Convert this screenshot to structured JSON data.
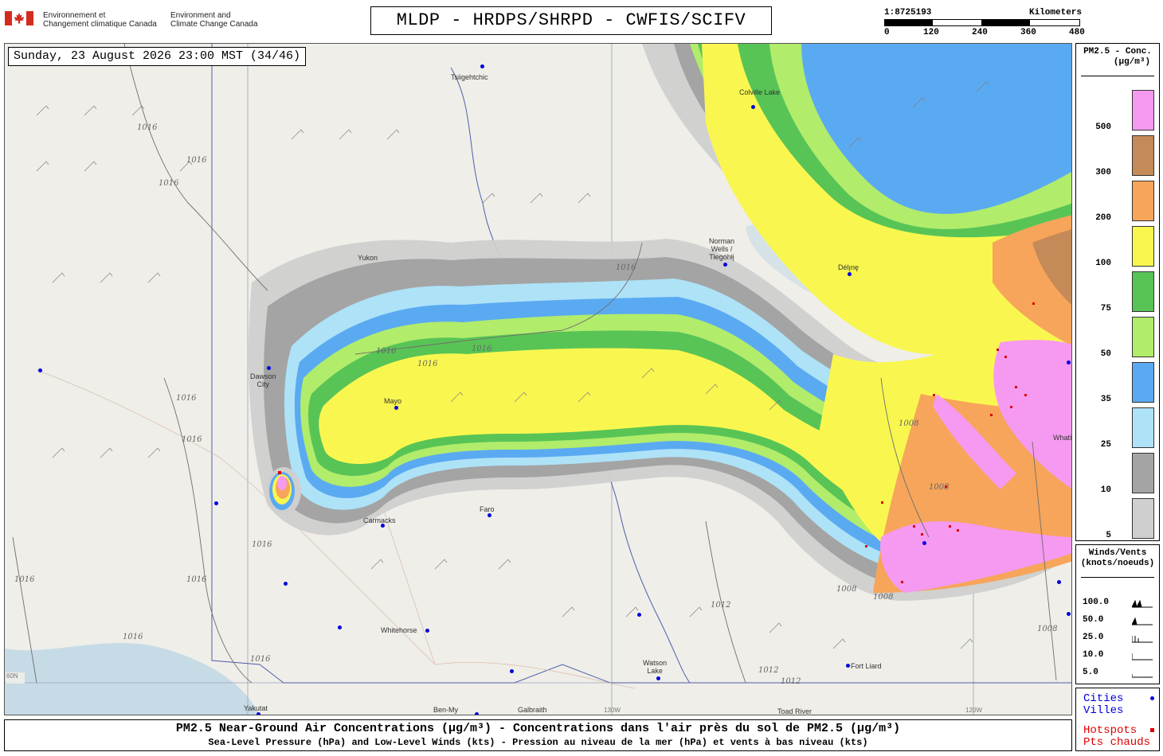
{
  "header": {
    "gov_fr": [
      "Environnement et",
      "Changement climatique Canada"
    ],
    "gov_en": [
      "Environment and",
      "Climate Change Canada"
    ],
    "title": "MLDP - HRDPS/SHRPD - CWFIS/SCIFV",
    "scale_ratio": "1:8725193",
    "scale_unit": "Kilometers",
    "scale_ticks": [
      "0",
      "120",
      "240",
      "360",
      "480"
    ]
  },
  "map": {
    "timestamp": "Sunday, 23 August 2026 23:00 MST (34/46)",
    "places": {
      "tsiigehtchic": "Tsiigehtchic",
      "colville": "Colville Lake",
      "norman_wells": [
        "Norman",
        "Wells /",
        "Tłegóhłį"
      ],
      "deline": "Délı̨nę",
      "yukon": "Yukon",
      "dawson": [
        "Dawson",
        "City"
      ],
      "mayo": "Mayo",
      "carmacks": "Carmacks",
      "faro": "Faro",
      "whitehorse": "Whitehorse",
      "watson_lake": [
        "Watson",
        "Lake"
      ],
      "fort_liard": "Fort Liard",
      "yakutat": "Yakutat",
      "ben_my": "Ben-My",
      "galbraith": "Galbraith",
      "toad_river": "Toad River",
      "whati": "Whatì"
    },
    "isobar_label": "1016",
    "isobar_label_1008": "1008",
    "isobar_label_1012": "1012",
    "grid_labels": [
      "60N",
      "130W",
      "120W"
    ]
  },
  "legend_pm": {
    "title": [
      "PM2.5 - Conc.",
      "(µg/m³)"
    ],
    "levels": [
      {
        "label": "500",
        "color": "#f59af0"
      },
      {
        "label": "300",
        "color": "#c48a57"
      },
      {
        "label": "200",
        "color": "#f7a55a"
      },
      {
        "label": "100",
        "color": "#f9f74f"
      },
      {
        "label": "75",
        "color": "#58c456"
      },
      {
        "label": "50",
        "color": "#b1ec6b"
      },
      {
        "label": "35",
        "color": "#5aaaf2"
      },
      {
        "label": "25",
        "color": "#aee2f7"
      },
      {
        "label": "10",
        "color": "#a4a4a4"
      },
      {
        "label": "5",
        "color": "#cfcfcf"
      }
    ]
  },
  "legend_wind": {
    "title": [
      "Winds/Vents",
      "(knots/noeuds)"
    ],
    "rows": [
      "100.0",
      "50.0",
      "25.0",
      "10.0",
      "5.0"
    ]
  },
  "legend_symbols": {
    "cities": [
      "Cities",
      "Villes"
    ],
    "cities_color": "#0000dd",
    "hotspots": [
      "Hotspots",
      "Pts chauds"
    ],
    "hotspots_color": "#dd0000"
  },
  "footer": {
    "line1": "PM2.5 Near-Ground Air Concentrations (µg/m³) - Concentrations dans l'air près du sol de PM2.5 (µg/m³)",
    "line2": "Sea-Level Pressure (hPa) and Low-Level Winds (kts) - Pression au niveau de la mer (hPa) et vents à bas niveau (kts)"
  }
}
